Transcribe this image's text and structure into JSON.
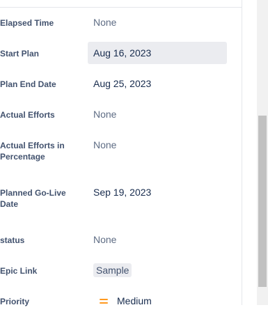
{
  "fields": [
    {
      "label": "Elapsed Time",
      "value": "None"
    },
    {
      "label": "Start Plan",
      "value": "Aug 16, 2023"
    },
    {
      "label": "Plan End Date",
      "value": "Aug 25, 2023"
    },
    {
      "label": "Actual Efforts",
      "value": "None"
    },
    {
      "label": "Actual Efforts in Percentage",
      "value": "None"
    },
    {
      "label": "Planned Go-Live Date",
      "value": "Sep 19, 2023"
    },
    {
      "label": "status",
      "value": "None"
    },
    {
      "label": "Epic Link",
      "value": "Sample"
    },
    {
      "label": "Priority",
      "value": "Medium",
      "icon": "medium-priority-icon",
      "icon_color": "#ff991f"
    }
  ],
  "colors": {
    "label": "#42526e",
    "value": "#172b4d",
    "none_value": "#5e6c84",
    "active_bg": "#ebecf0",
    "priority_medium": "#ff991f"
  }
}
